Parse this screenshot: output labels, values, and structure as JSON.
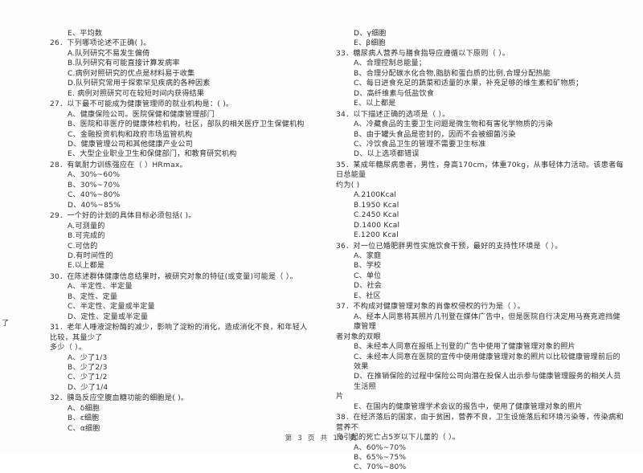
{
  "document": {
    "page_footer": "第 3 页 共 10 页",
    "page_number": "3",
    "total_pages": "10"
  },
  "left_column": {
    "orphan_option": "E、平均数",
    "questions": [
      {
        "stem": "26．下列哪项论述不正确(        )。",
        "options": [
          "A.队列研究不易发生偏倚",
          "B.队列研究有可能直接计算发病率",
          "C.病例对照研究的优点是材料易于收集",
          "D.队列研究常用于探索罕见疾病的各种因素",
          "E.  病例对照研究可在较短时间内获得结果"
        ]
      },
      {
        "stem": "27．以下最不可能成为健康管理师的就业机构是：(        )。",
        "options": [
          "A、健康保险公司。医院保健和健康管理部门",
          "B、医院和非医疗的健康体检机构，社区，部队的相关医疗卫生保健机构",
          "C、金融投资机构和政府市场监管机构",
          "D、健康管理公司和其他健康产业公司",
          "E、大型企业职业卫生和保健部门，和教育研究机构"
        ]
      },
      {
        "stem": "28．有氧耐力训练强应在（        ）HRmax。",
        "options": [
          "A、30%~60%",
          "B、30%~70%",
          "C、40%~80%",
          "D、40%~85%"
        ]
      },
      {
        "stem": "29．一个好的计划的具体目标必须包括(        )。",
        "options": [
          "A.可测量的",
          "B.可完成的",
          "C.可信的",
          "D.有时间性的",
          "E.以上都是"
        ]
      },
      {
        "stem": "30．在陈述群体健康信息结果时，被研究对象的特征(或变量)可能是（        ）。",
        "options": [
          "A、半定性、半定量",
          "B、定性、定量",
          "C、半定性、定量或半定量",
          "D、定性、定量或半定量"
        ]
      },
      {
        "stem": "31．老年人唾液淀粉酶的减少，影响了淀粉的消化，造成消化不良，和年轻人比较，其量少了",
        "stem_cont": "多少（        ）。",
        "options": [
          "A、少了1/3",
          "B、少了2/3",
          "C、少了1/2",
          "D、少了1/4"
        ]
      },
      {
        "stem": "32．胰岛反应空腹血糖功能的细胞是(        )。",
        "options": [
          "A、δ细胞",
          "B、ε细胞",
          "C、α细胞"
        ]
      }
    ]
  },
  "right_column": {
    "orphan_options": [
      "D、γ细胞",
      "E、β细胞"
    ],
    "questions": [
      {
        "stem": "33．糖尿病人营养与膳食指导应遵循以下原则（        ）。",
        "options": [
          "A、合理控制总能量；",
          "B、合理分配碳水化合物,脂肪和蛋白质的比例,合理分配热能",
          "C、每日进食充足的蔬菜和适量的水果，补充足够的维生素和矿物质；",
          "D、高纤维素与低盐饮食",
          "E、以上都是"
        ]
      },
      {
        "stem": "34．以下描述正确的选项是（        ）。",
        "options": [
          "A、冷藏食品的主要卫生问题是微生物和有害化学物质的污染",
          "B、由于罐头食品是密封的，因而不会被细菌污染",
          "C、冷饮食品卫生的管理不需要卫生标准",
          "D、以上选项都错误"
        ]
      },
      {
        "stem": "35．某成年糖尿病患者，男性，身高170cm，体重70kg，从事轻体力活动。该患者每日总能量",
        "stem_cont": "约为(    )",
        "options": [
          "A.2100Kcal",
          "B.1950 Kcal",
          "C.2450 Kcal",
          "D.1400 Kcal",
          "E.1200 Kcal"
        ]
      },
      {
        "stem": "36．对一位已婚肥胖男性实施饮食干预，最好的支持性环境是（        ）。",
        "options": [
          "A、家庭",
          "B、学校",
          "C、单位",
          "D、社会",
          "E、社区"
        ]
      },
      {
        "stem": "37．不构成对健康管理对象的肖像权侵权的行为是（        ）。",
        "options": [
          "A、经本人同意将其照片几刊登在媒体广告中，但是医院自行决定用马赛克遮挡健康管理",
          "B、未经本人同意在报纸上刊登的广告中使用了健康管理对象的照片",
          "C、未经本人同意在医院的宣传中使用健康管理对象的照片以比较健康管理前后的效果",
          "D、在推销保险的过程中保险公司向潜在投保人出示参与健康管理服务的相关人员生活照",
          "E、在国内的健康管理学术会议的报告中，使用了健康管理对象的照片"
        ],
        "option_continuations": {
          "A": "者对象的双眼",
          "D": "片"
        }
      },
      {
        "stem": "38．在经济落后的国家，由于贫困，营养不良，卫生设施落后和环境污染等，传染病和营养不",
        "stem_cont": "良引起的死亡占5岁以下儿童的（        ）。",
        "options": [
          "A、60%~70%",
          "B、65%~75%",
          "C、70%~80%"
        ]
      }
    ]
  },
  "margin_fragments": {
    "left_edge_mark": "了"
  }
}
